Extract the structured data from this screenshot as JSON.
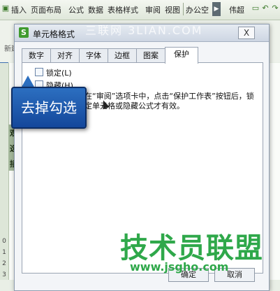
{
  "menubar": {
    "items": [
      "插入",
      "页面布局",
      "公式",
      "数据",
      "表格样式",
      "审阅",
      "视图",
      "办公空"
    ],
    "right_text": "伟超"
  },
  "ribbon": {
    "label": "新建格式"
  },
  "sheet": {
    "cells": [
      "观",
      "选",
      "插"
    ],
    "row_numbers": [
      "0",
      "1",
      "2",
      "3"
    ]
  },
  "dialog": {
    "title": "单元格格式",
    "close": "X",
    "tabs": [
      "数字",
      "对齐",
      "字体",
      "边框",
      "图案",
      "保护"
    ],
    "active_tab": "保护",
    "options": [
      {
        "label": "锁定(L)",
        "checked": false
      },
      {
        "label": "隐藏(H)",
        "checked": false
      }
    ],
    "note": "在“审阅”选项卡中，点击“保护工作表”按钮后，锁定单元格或隐藏公式才有效。",
    "buttons": [
      "确定",
      "取消"
    ]
  },
  "callout": {
    "text": "去掉勾选"
  },
  "watermarks": {
    "top": "三联网 3LIAN.COM",
    "main": "技术员联盟",
    "url": "www.jsgho.com"
  }
}
